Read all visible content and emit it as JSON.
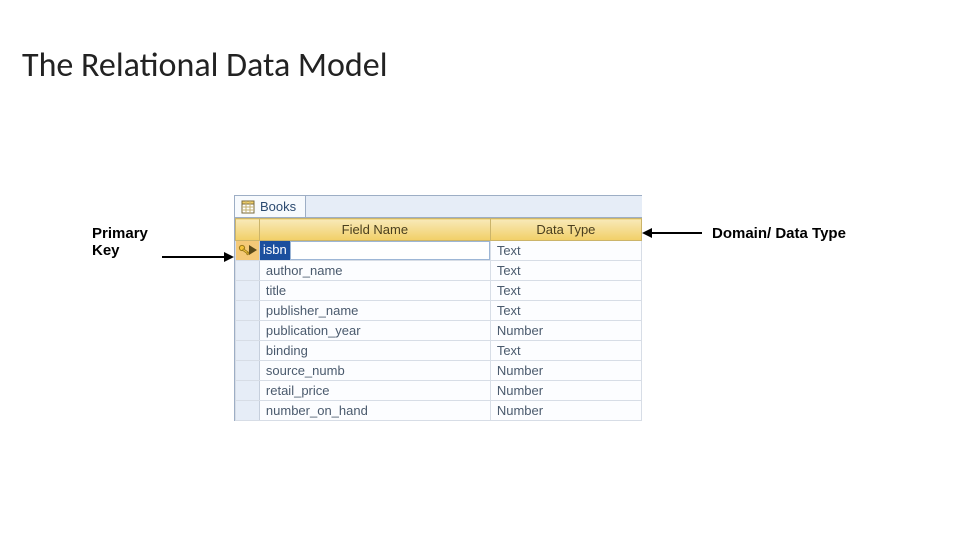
{
  "title": "The Relational Data Model",
  "annotations": {
    "primary_key": "Primary Key",
    "domain_type": "Domain/ Data Type"
  },
  "tab": {
    "label": "Books"
  },
  "headers": {
    "field_name": "Field Name",
    "data_type": "Data Type"
  },
  "rows": [
    {
      "field": "isbn",
      "type": "Text",
      "pk": true,
      "selected": true
    },
    {
      "field": "author_name",
      "type": "Text",
      "pk": false,
      "selected": false
    },
    {
      "field": "title",
      "type": "Text",
      "pk": false,
      "selected": false
    },
    {
      "field": "publisher_name",
      "type": "Text",
      "pk": false,
      "selected": false
    },
    {
      "field": "publication_year",
      "type": "Number",
      "pk": false,
      "selected": false
    },
    {
      "field": "binding",
      "type": "Text",
      "pk": false,
      "selected": false
    },
    {
      "field": "source_numb",
      "type": "Number",
      "pk": false,
      "selected": false
    },
    {
      "field": "retail_price",
      "type": "Number",
      "pk": false,
      "selected": false
    },
    {
      "field": "number_on_hand",
      "type": "Number",
      "pk": false,
      "selected": false
    }
  ]
}
